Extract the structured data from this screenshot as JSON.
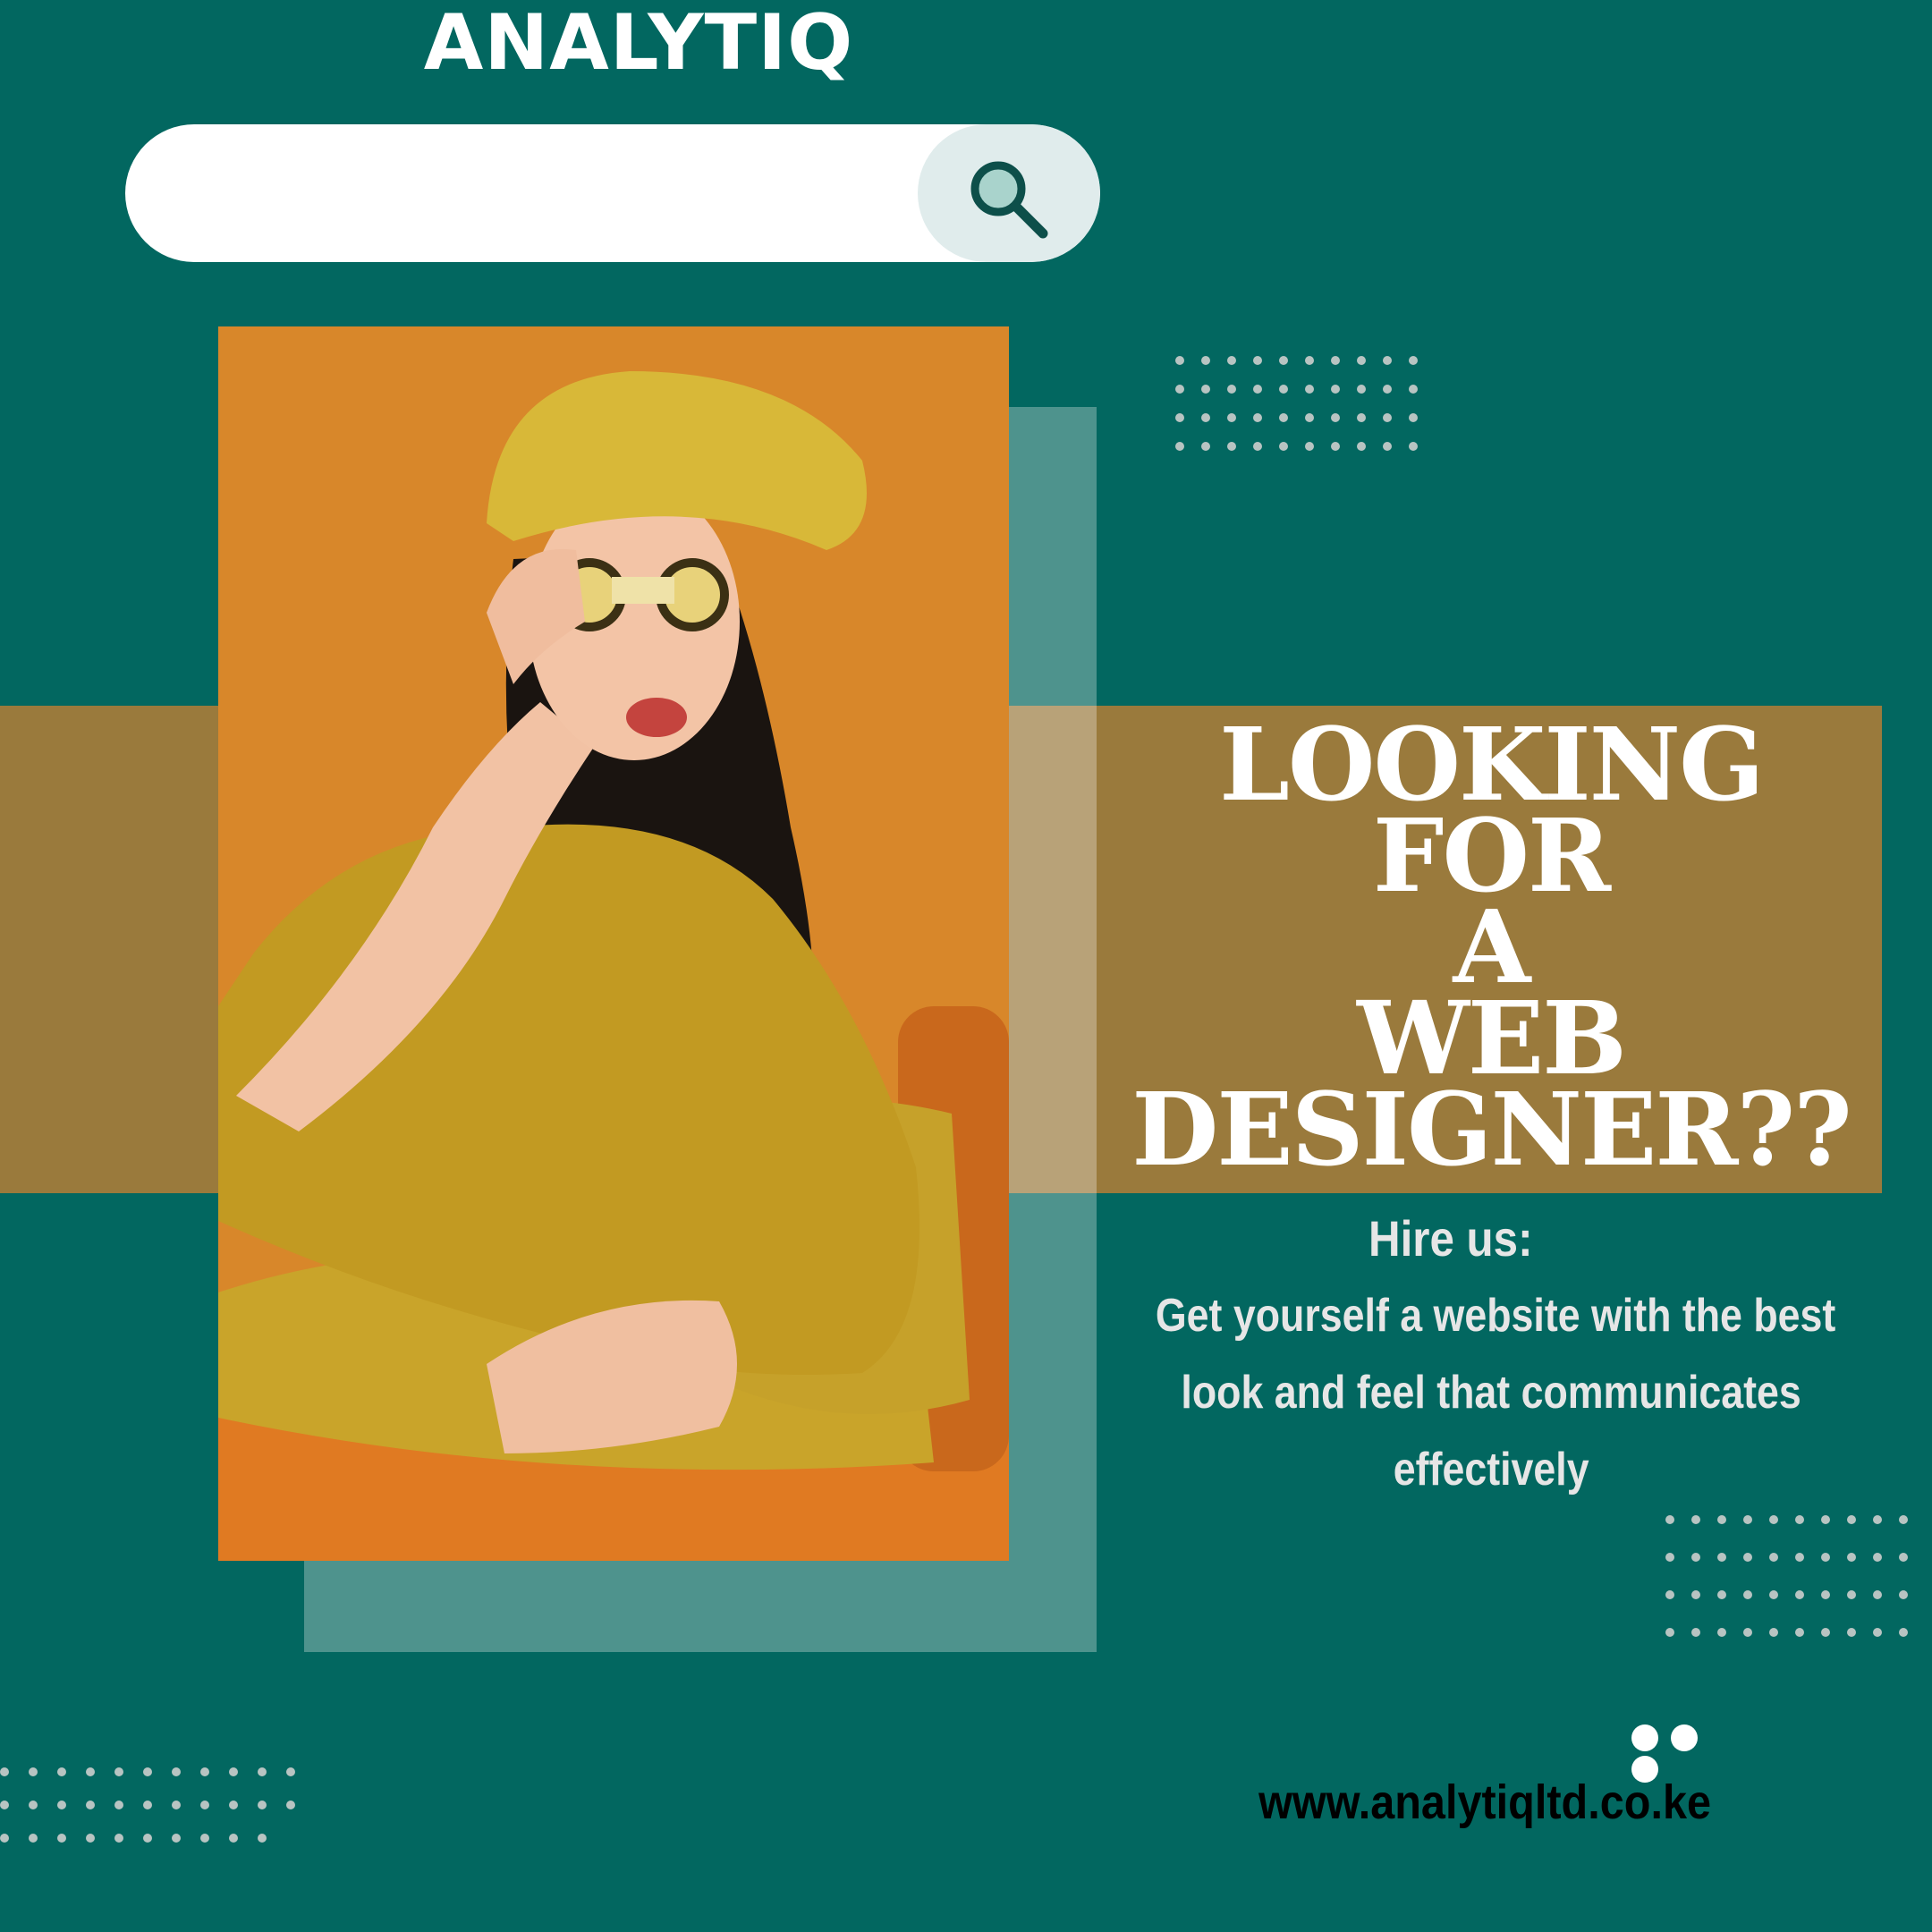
{
  "brand": {
    "name": "ANALYTIQ"
  },
  "search": {
    "icon": "search-icon",
    "placeholder": ""
  },
  "headline": {
    "lines": [
      "LOOKING",
      "FOR",
      "A",
      "WEB",
      "DESIGNER??"
    ]
  },
  "body": {
    "hire": "Hire us:",
    "pitch_lines": [
      "Get yourself a website with the best",
      "look and feel  that communicates",
      "effectively"
    ]
  },
  "footer": {
    "url": "www.analytiqltd.co.ke"
  },
  "colors": {
    "background": "#026760",
    "band": "#9a7a3c",
    "panel": "#4e938d",
    "photo_bg": "#d8872a"
  }
}
